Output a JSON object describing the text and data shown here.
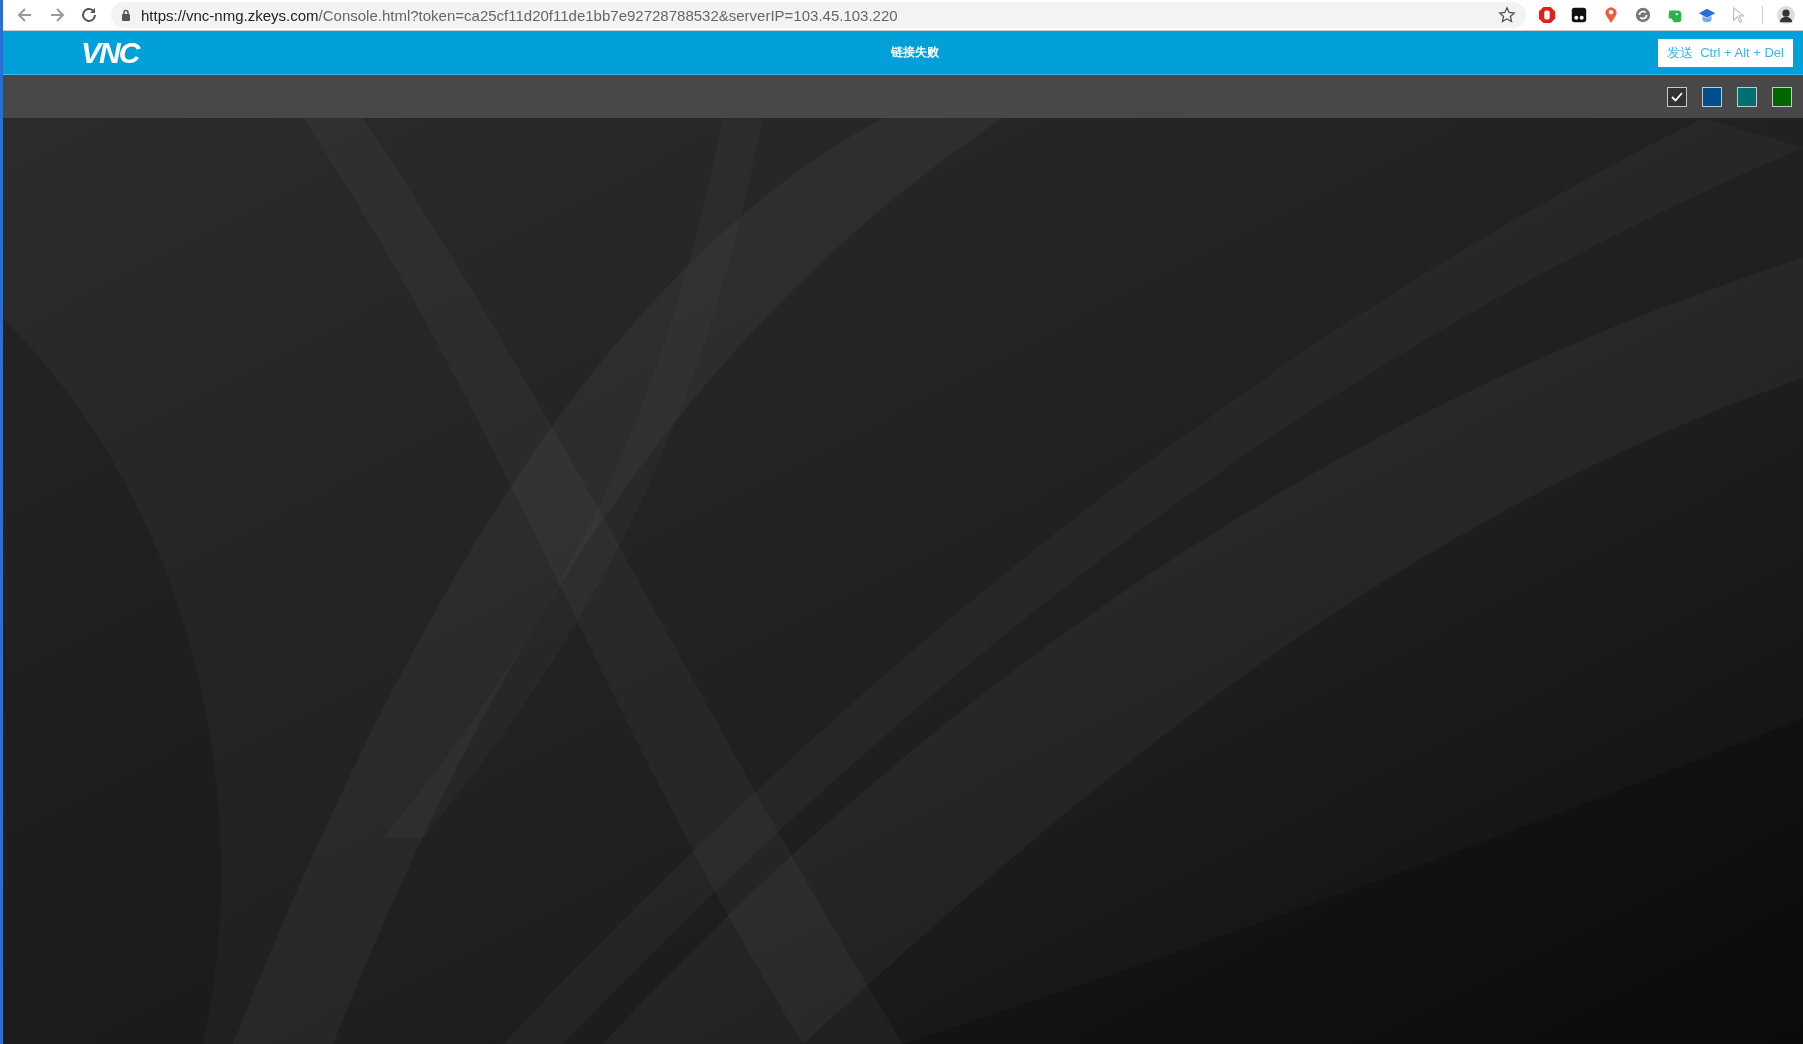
{
  "browser": {
    "url_host": "https://vnc-nmg.zkeys.com",
    "url_path": "/Console.html?token=ca25cf11d20f11de1bb7e92728788532&serverIP=103.45.103.220"
  },
  "header": {
    "logo": "VNC",
    "status": "链接失败",
    "send_button": "发送  Ctrl + Alt + Del"
  },
  "themes": [
    {
      "color": "#333333",
      "selected": true
    },
    {
      "color": "#004e8c",
      "selected": false
    },
    {
      "color": "#007070",
      "selected": false
    },
    {
      "color": "#006600",
      "selected": false
    }
  ]
}
